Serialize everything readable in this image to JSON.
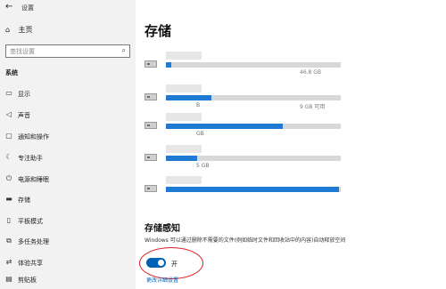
{
  "window": {
    "title": "设置",
    "back_glyph": "←"
  },
  "sidebar": {
    "home_label": "主页",
    "search_placeholder": "查找设置",
    "section_label": "系统",
    "items": [
      {
        "label": "显示",
        "icon": "display-icon",
        "glyph": "▭"
      },
      {
        "label": "声音",
        "icon": "sound-icon",
        "glyph": "◁"
      },
      {
        "label": "通知和操作",
        "icon": "notification-icon",
        "glyph": "▢"
      },
      {
        "label": "专注助手",
        "icon": "moon-icon",
        "glyph": "☾"
      },
      {
        "label": "电源和睡眠",
        "icon": "power-icon",
        "glyph": "⏻"
      },
      {
        "label": "存储",
        "icon": "storage-icon",
        "glyph": "▬"
      },
      {
        "label": "平板模式",
        "icon": "tablet-icon",
        "glyph": "▯"
      },
      {
        "label": "多任务处理",
        "icon": "multitask-icon",
        "glyph": "⧉"
      },
      {
        "label": "体验共享",
        "icon": "share-icon",
        "glyph": "⇄"
      },
      {
        "label": "剪贴板",
        "icon": "clipboard-icon",
        "glyph": "▤"
      }
    ]
  },
  "main": {
    "title": "存储",
    "drives": [
      {
        "fill": 0.03,
        "meta": "",
        "meta_right": "46.8 GB"
      },
      {
        "fill": 0.26,
        "meta": "B",
        "meta_right": "9 GB 可用"
      },
      {
        "fill": 0.67,
        "meta": "GB",
        "meta_right": ""
      },
      {
        "fill": 0.18,
        "meta": "5 GB",
        "meta_right": ""
      },
      {
        "fill": 0.99,
        "meta": "",
        "meta_right": ""
      }
    ],
    "storage_sense": {
      "title": "存储感知",
      "description": "Windows 可以通过删除不需要的文件(例如临时文件和回收站中的内容)自动释放空间",
      "toggle_state": "开",
      "toggle_on": true,
      "link": "更改详细设置"
    }
  },
  "colors": {
    "accent": "#0063b1",
    "bar_fill": "#1e7ad3",
    "annotation": "#d9201f"
  }
}
